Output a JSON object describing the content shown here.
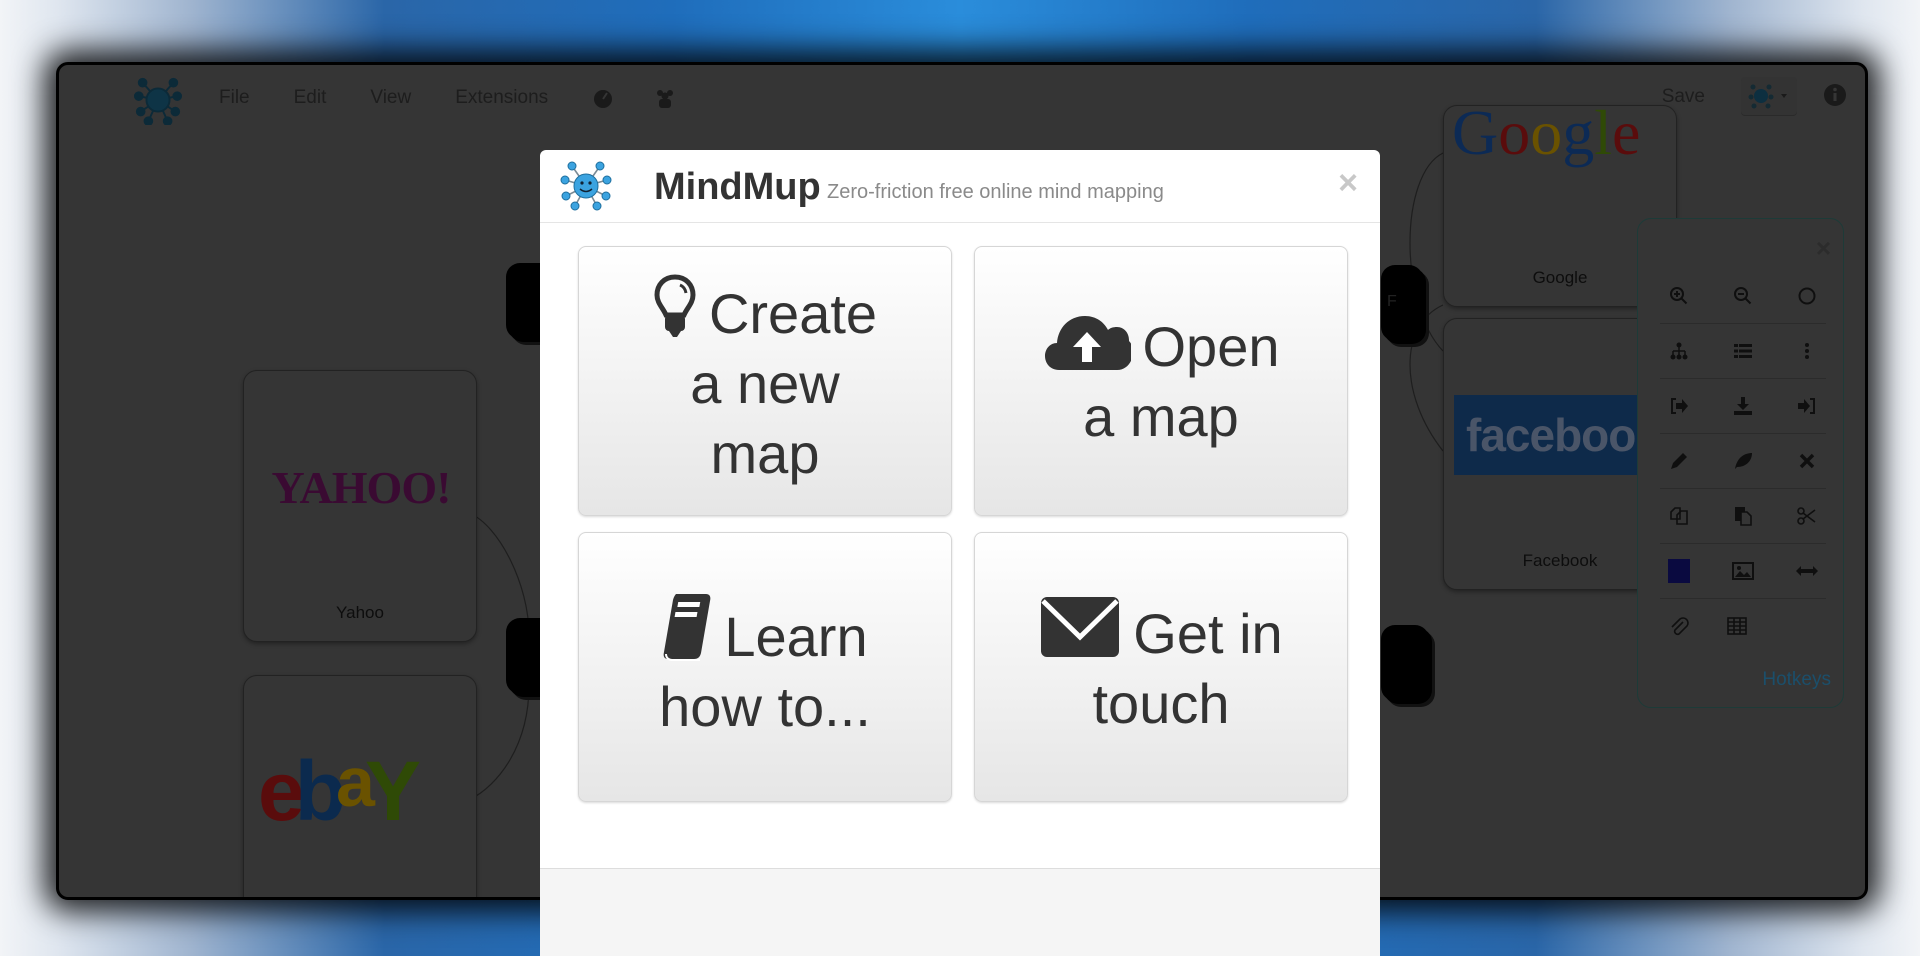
{
  "app": {
    "menu": [
      "File",
      "Edit",
      "View",
      "Extensions"
    ],
    "menu_icons": [
      "dashboard-icon",
      "group-icon"
    ],
    "save_label": "Save",
    "theme_dropdown_icon": "mindmup-logo-icon",
    "info_icon": "info-icon"
  },
  "map": {
    "nodes": [
      {
        "label": "Yahoo",
        "logo_text": "YAHOO!",
        "logo_color": "#3a0a32"
      },
      {
        "label": "",
        "logo_text": "ebaY",
        "logo_colors": [
          "#5a0c0c",
          "#0b2a4e",
          "#6a5200",
          "#2f4a06"
        ]
      },
      {
        "label": "Google",
        "logo_text": "Google"
      },
      {
        "label": "Facebook",
        "logo_text": "facebook",
        "logo_bg": "#0e2a4a"
      }
    ],
    "hidden_node_fragment": "F"
  },
  "toolbox": {
    "rows": [
      [
        "zoom-in-icon",
        "zoom-out-icon",
        "circle-icon"
      ],
      [
        "hierarchy-icon",
        "list-icon",
        "more-vertical-icon"
      ],
      [
        "export-icon",
        "download-icon",
        "import-icon"
      ],
      [
        "pencil-icon",
        "leaf-icon",
        "delete-icon"
      ],
      [
        "copy-icon",
        "paste-icon",
        "cut-icon"
      ],
      [
        "color-swatch-icon",
        "image-icon",
        "horizontal-arrows-icon"
      ],
      [
        "attachment-icon",
        "table-icon"
      ]
    ],
    "swatch_color": "#0a0a40",
    "hotkeys_label": "Hotkeys"
  },
  "modal": {
    "title": "MindMup",
    "subtitle": "Zero-friction free online mind mapping",
    "close_icon": "×",
    "tiles": [
      {
        "icon": "lightbulb-icon",
        "line1": "Create",
        "line2": "a new",
        "line3": "map"
      },
      {
        "icon": "cloud-upload-icon",
        "line1": "Open",
        "line2": "a map",
        "line3": ""
      },
      {
        "icon": "book-icon",
        "line1": "Learn",
        "line2": "how to...",
        "line3": ""
      },
      {
        "icon": "envelope-icon",
        "line1": "Get in",
        "line2": "touch",
        "line3": ""
      }
    ]
  }
}
